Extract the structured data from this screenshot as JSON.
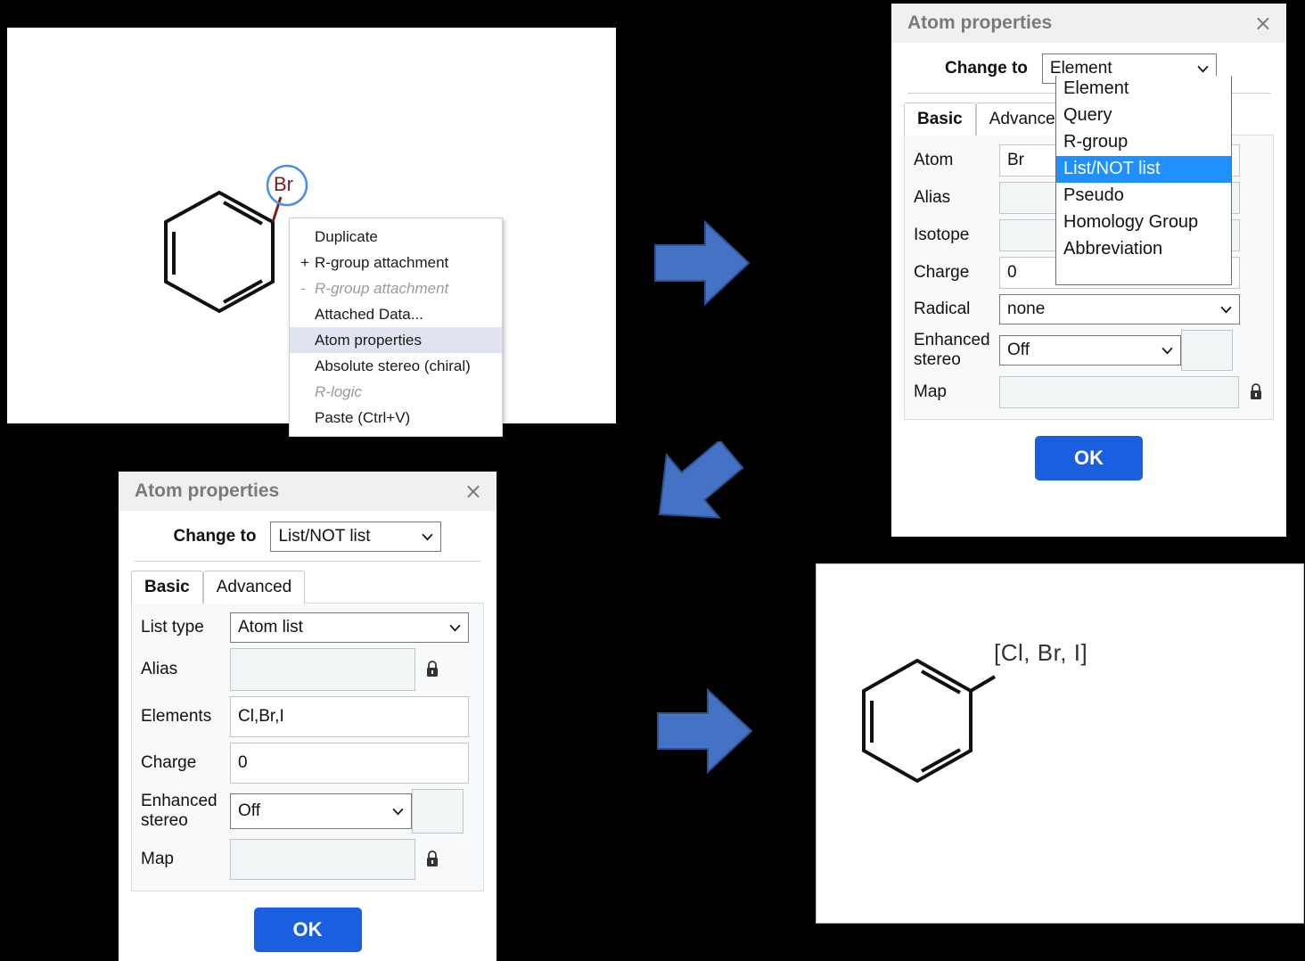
{
  "canvas_top_left": {
    "atom_label": "Br",
    "atom_color": "#7a2020",
    "selection_color": "#4a90e2"
  },
  "context_menu": {
    "items": [
      {
        "sign": "",
        "label": "Duplicate",
        "state": "normal"
      },
      {
        "sign": "+",
        "label": "R-group attachment",
        "state": "normal"
      },
      {
        "sign": "-",
        "label": "R-group attachment",
        "state": "disabled"
      },
      {
        "sign": "",
        "label": "Attached Data...",
        "state": "normal"
      },
      {
        "sign": "",
        "label": "Atom properties",
        "state": "selected"
      },
      {
        "sign": "",
        "label": "Absolute stereo (chiral)",
        "state": "normal"
      },
      {
        "sign": "",
        "label": "R-logic",
        "state": "disabled"
      },
      {
        "sign": "",
        "label": "Paste (Ctrl+V)",
        "state": "normal"
      }
    ]
  },
  "dialog_element": {
    "title": "Atom properties",
    "close_label": "×",
    "change_to_label": "Change to",
    "change_to_value": "Element",
    "tabs": [
      {
        "label": "Basic",
        "active": true
      },
      {
        "label": "Advanced",
        "active": false
      }
    ],
    "fields": {
      "atom_label": "Atom",
      "atom_value": "Br",
      "alias_label": "Alias",
      "alias_value": "",
      "isotope_label": "Isotope",
      "isotope_value": "",
      "charge_label": "Charge",
      "charge_value": "0",
      "radical_label": "Radical",
      "radical_value": "none",
      "enhanced_stereo_label": "Enhanced stereo",
      "enhanced_stereo_value": "Off",
      "enhanced_stereo_extra": "",
      "map_label": "Map",
      "map_value": ""
    },
    "ok_label": "OK",
    "ok_color": "#1a5fe0"
  },
  "dropdown_popup": {
    "options": [
      {
        "label": "Element",
        "highlight": false
      },
      {
        "label": "Query",
        "highlight": false
      },
      {
        "label": "R-group",
        "highlight": false
      },
      {
        "label": "List/NOT list",
        "highlight": true
      },
      {
        "label": "Pseudo",
        "highlight": false
      },
      {
        "label": "Homology Group",
        "highlight": false
      },
      {
        "label": "Abbreviation",
        "highlight": false
      }
    ],
    "highlight_color": "#1e90ff"
  },
  "dialog_list": {
    "title": "Atom properties",
    "close_label": "×",
    "change_to_label": "Change to",
    "change_to_value": "List/NOT list",
    "tabs": [
      {
        "label": "Basic",
        "active": true
      },
      {
        "label": "Advanced",
        "active": false
      }
    ],
    "fields": {
      "list_type_label": "List type",
      "list_type_value": "Atom list",
      "alias_label": "Alias",
      "alias_value": "",
      "elements_label": "Elements",
      "elements_value": "Cl,Br,I",
      "charge_label": "Charge",
      "charge_value": "0",
      "enhanced_stereo_label": "Enhanced stereo",
      "enhanced_stereo_value": "Off",
      "enhanced_stereo_extra": "",
      "map_label": "Map",
      "map_value": ""
    },
    "ok_label": "OK",
    "ok_color": "#1a5fe0"
  },
  "canvas_bottom_right": {
    "atom_label": "[Cl, Br, I]",
    "atom_color": "#333333"
  },
  "arrows": {
    "color": "#4472c4",
    "stroke": "#2f528f",
    "items": [
      {
        "name": "arrow-step-1",
        "direction": "right"
      },
      {
        "name": "arrow-step-2",
        "direction": "down-left"
      },
      {
        "name": "arrow-step-3",
        "direction": "right"
      }
    ]
  }
}
